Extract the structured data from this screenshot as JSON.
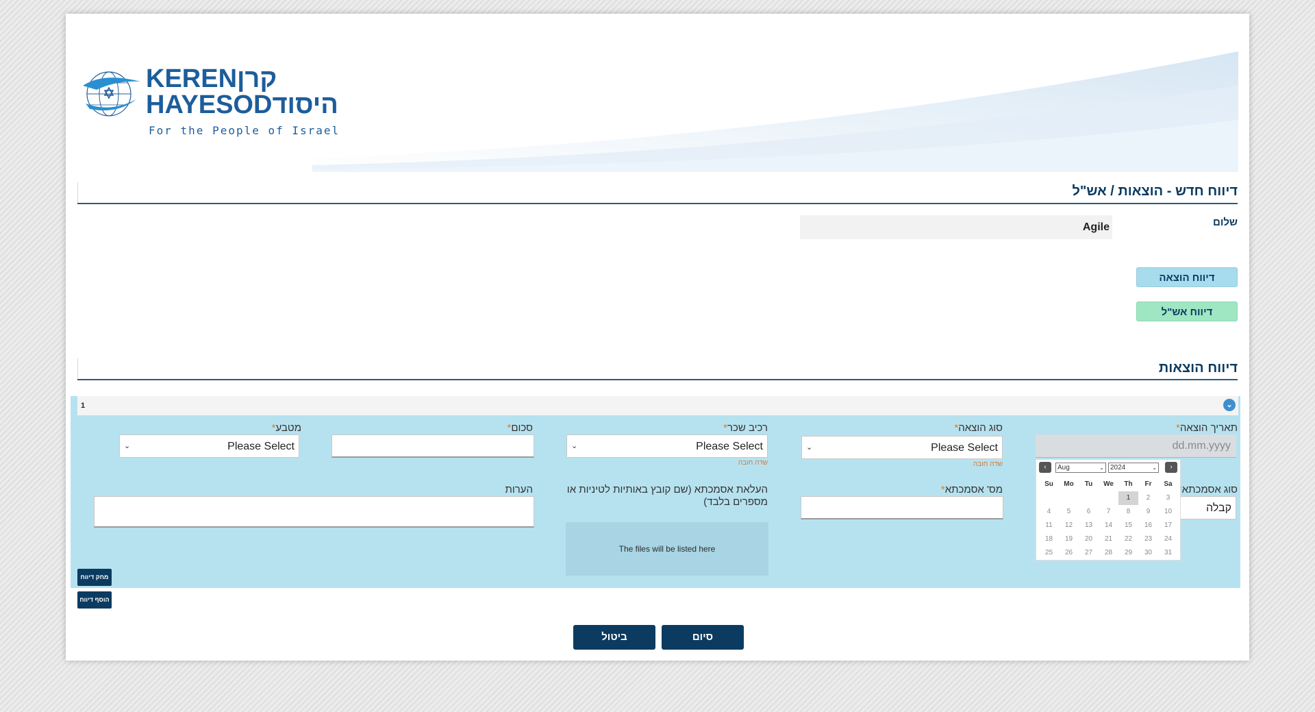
{
  "logo": {
    "line1": "KERENקרן",
    "line2": "HAYESODהיסוד",
    "tagline": "For the People of Israel"
  },
  "page_title": "דיווח חדש - הוצאות / אש\"ל",
  "greeting": {
    "label": "שלום",
    "name": "Agile"
  },
  "side_buttons": {
    "expense": "דיווח הוצאה",
    "per_diem": "דיווח אש\"ל"
  },
  "expenses_section": {
    "title": "דיווח הוצאות",
    "row_number": "1"
  },
  "form": {
    "expense_date_label": "תאריך הוצאה",
    "expense_date_placeholder": "dd.mm.yyyy",
    "expense_type_label": "סוג הוצאה",
    "expense_type_value": "Please Select",
    "required_hint": "שדה חובה",
    "vehicle_label": "רכיב שכר",
    "vehicle_value": "Please Select",
    "amount_label": "סכום",
    "currency_label": "מטבע",
    "currency_value": "Please Select",
    "asterisk": "*",
    "doc_type_label": "סוג אסמכתא",
    "doc_type_value": "קבלה",
    "doc_number_label": "מס' אסמכתא",
    "upload_label": "העלאת אסמכתא (שם קובץ באותיות לטיניות או מספרים בלבד)",
    "files_placeholder": "The files will be listed here",
    "notes_label": "הערות"
  },
  "calendar": {
    "prev": "‹",
    "next": "›",
    "month": "Aug",
    "year": "2024",
    "days": [
      "Su",
      "Mo",
      "Tu",
      "We",
      "Th",
      "Fr",
      "Sa"
    ],
    "weeks": [
      [
        "",
        "",
        "",
        "",
        "1",
        "2",
        "3"
      ],
      [
        "4",
        "5",
        "6",
        "7",
        "8",
        "9",
        "10"
      ],
      [
        "11",
        "12",
        "13",
        "14",
        "15",
        "16",
        "17"
      ],
      [
        "18",
        "19",
        "20",
        "21",
        "22",
        "23",
        "24"
      ],
      [
        "25",
        "26",
        "27",
        "28",
        "29",
        "30",
        "31"
      ]
    ],
    "selected": "1"
  },
  "actions": {
    "delete_report": "מחק דיווח",
    "add_report": "הוסף דיווח",
    "finish": "סיום",
    "cancel": "ביטול"
  },
  "colors": {
    "primary": "#0b3b60",
    "form_bg": "#b6e2f0",
    "accent_blue": "#a6dcee",
    "accent_green": "#9fe6c2"
  }
}
